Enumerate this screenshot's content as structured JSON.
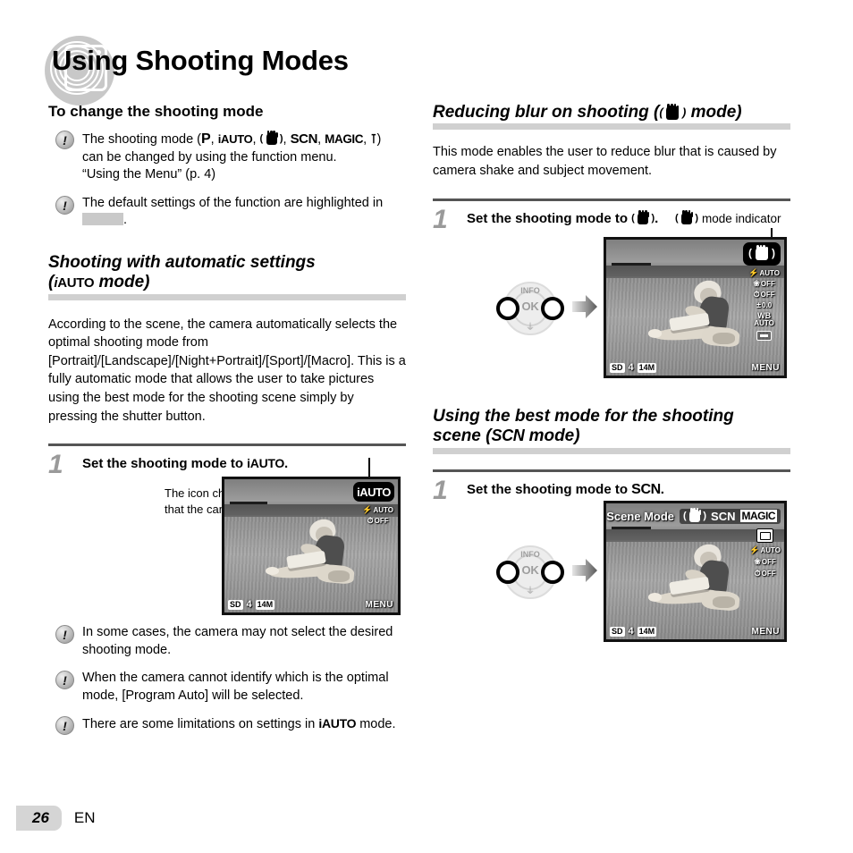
{
  "page": {
    "title": "Using Shooting Modes",
    "number": "26",
    "language": "EN"
  },
  "left_column": {
    "subhead": "To change the shooting mode",
    "notes": [
      {
        "line1_pre": "The shooting mode (",
        "modes": [
          "P",
          "iAUTO",
          "hand-shake",
          "SCN",
          "MAGIC",
          "panorama"
        ],
        "line1_post": ")",
        "line2": "can be changed by using the function menu.",
        "line3": "“Using the Menu” (p. 4)"
      },
      {
        "line1": "The default settings of the function are highlighted in",
        "line2_suffix": "."
      }
    ],
    "section": {
      "heading_line1": "Shooting with automatic settings",
      "heading_line2_pre": "(",
      "heading_mode": "iAUTO",
      "heading_line2_post": " mode)",
      "body": "According to the scene, the camera automatically selects the optimal shooting mode from [Portrait]/[Landscape]/[Night+Portrait]/[Sport]/[Macro]. This is a fully automatic mode that allows the user to take pictures using the best mode for the shooting scene simply by pressing the shutter button.",
      "step_number": "1",
      "step_text_pre": "Set the shooting mode to ",
      "step_mode": "iAUTO",
      "step_text_post": ".",
      "caption": "The icon changes depending on the scene that the camera automatically selects."
    },
    "lcd": {
      "mode_badge": "iAUTO",
      "osd": [
        {
          "icon": "flash-icon",
          "glyph": "⚡",
          "value": "AUTO"
        },
        {
          "icon": "self-timer-icon",
          "glyph": "⏱",
          "value": "OFF"
        }
      ],
      "bottom": {
        "card_icon": "sd-card-icon",
        "card_label": "SD",
        "shots_remaining": "4",
        "image_size": "14M",
        "menu_label": "MENU"
      }
    },
    "after_notes": [
      "In some cases, the camera may not select the desired shooting mode.",
      "When the camera cannot identify which is the optimal mode, [Program Auto] will be selected.",
      "There are some limitations on settings in"
    ],
    "after_note3_suffix": " mode.",
    "after_note3_mode": "iAUTO"
  },
  "right_column": {
    "section_blur": {
      "heading_pre": "Reducing blur on shooting (",
      "heading_mode": "hand-shake",
      "heading_post": " mode)",
      "body": "This mode enables the user to reduce blur that is caused by camera shake and subject movement.",
      "step_number": "1",
      "step_text_pre": "Set the shooting mode to ",
      "step_text_post": ".",
      "callout": "mode indicator",
      "lcd": {
        "mode_badge": "hand-shake",
        "osd": [
          {
            "icon": "flash-icon",
            "glyph": "⚡",
            "value": "AUTO"
          },
          {
            "icon": "macro-icon",
            "glyph": "❀",
            "value": "OFF"
          },
          {
            "icon": "self-timer-icon",
            "glyph": "⏱",
            "value": "OFF"
          },
          {
            "icon": "exposure-comp-icon",
            "glyph": "±",
            "value": "0.0"
          },
          {
            "icon": "white-balance-icon",
            "glyph": "WB",
            "value": "AUTO"
          },
          {
            "icon": "drive-mode-icon",
            "glyph": "",
            "value": ""
          }
        ],
        "bottom": {
          "card_label": "SD",
          "shots_remaining": "4",
          "image_size": "14M",
          "menu_label": "MENU"
        }
      }
    },
    "section_scn": {
      "heading_line1": "Using the best mode for the shooting",
      "heading_line2_pre": "scene (",
      "heading_mode": "SCN",
      "heading_line2_post": " mode)",
      "step_number": "1",
      "step_text_pre": "Set the shooting mode to ",
      "step_mode": "SCN",
      "step_text_post": ".",
      "lcd": {
        "top_label": "Scene Mode",
        "top_modes": [
          "hand-shake",
          "SCN",
          "MAGIC"
        ],
        "top_scn": "SCN",
        "top_magic": "MAGIC",
        "osd": [
          {
            "icon": "scene-select-icon",
            "glyph": "",
            "value": ""
          },
          {
            "icon": "flash-icon",
            "glyph": "⚡",
            "value": "AUTO"
          },
          {
            "icon": "macro-icon",
            "glyph": "❀",
            "value": "OFF"
          },
          {
            "icon": "self-timer-icon",
            "glyph": "⏱",
            "value": "OFF"
          }
        ],
        "bottom": {
          "card_label": "SD",
          "shots_remaining": "4",
          "image_size": "14M",
          "menu_label": "MENU"
        }
      }
    }
  },
  "control_pad": {
    "info_label": "INFO",
    "ok_label": "OK",
    "trash_icon": "trash-icon",
    "left_button": "left-arrow-button",
    "right_button": "right-arrow-button",
    "arrow_icon": "right-arrow-icon"
  },
  "colors": {
    "heading_band": "#d0d0d0",
    "step_number": "#9a9a9a",
    "page_tab": "#d5d5d5",
    "rule": "#555555"
  }
}
